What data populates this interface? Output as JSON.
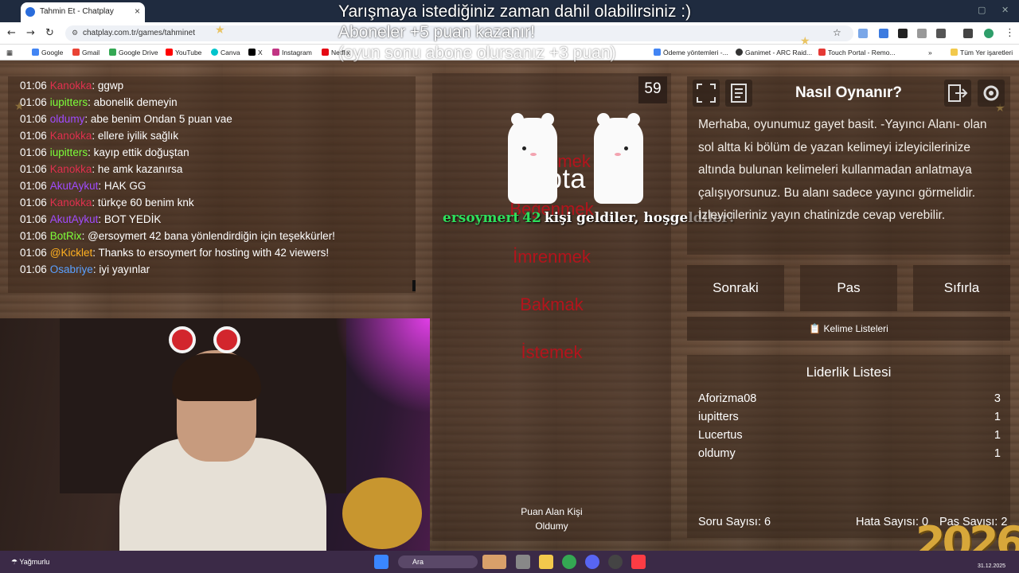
{
  "browser": {
    "tab_title": "Tahmin Et - Chatplay",
    "url": "chatplay.com.tr/games/tahminet",
    "bookmarks": [
      {
        "label": "Google",
        "color": "#4285f4"
      },
      {
        "label": "Gmail",
        "color": "#ea4335"
      },
      {
        "label": "Google Drive",
        "color": "#34a853"
      },
      {
        "label": "YouTube",
        "color": "#ff0000"
      },
      {
        "label": "Canva",
        "color": "#00c4cc"
      },
      {
        "label": "X",
        "color": "#000000"
      },
      {
        "label": "Instagram",
        "color": "#c13584"
      },
      {
        "label": "Netflix",
        "color": "#e50914"
      },
      {
        "label": "Ödeme yöntemleri -...",
        "color": "#4285f4"
      },
      {
        "label": "Ganimet - ARC Raid...",
        "color": "#333333"
      },
      {
        "label": "Touch Portal - Remo...",
        "color": "#e53935"
      }
    ],
    "all_bookmarks": "Tüm Yer işaretleri"
  },
  "announcement": {
    "line1": "Yarışmaya istediğiniz zaman dahil olabilirsiniz :)",
    "line2": "Aboneler +5 puan kazanır!",
    "line3": "(oyun sonu abone olursanız +3 puan)"
  },
  "chat": [
    {
      "time": "01:06",
      "user": "Kanokka",
      "color": "#e0304e",
      "msg": "ggwp"
    },
    {
      "time": "01:06",
      "user": "iupitters",
      "color": "#7dff3a",
      "msg": "abonelik demeyin"
    },
    {
      "time": "01:06",
      "user": "oldumy",
      "color": "#a04bff",
      "msg": "abe benim Ondan 5 puan vae"
    },
    {
      "time": "01:06",
      "user": "Kanokka",
      "color": "#e0304e",
      "msg": "ellere iyilik sağlık"
    },
    {
      "time": "01:06",
      "user": "iupitters",
      "color": "#7dff3a",
      "msg": "kayıp ettik doğuştan"
    },
    {
      "time": "01:06",
      "user": "Kanokka",
      "color": "#e0304e",
      "msg": "he amk kazanırsa"
    },
    {
      "time": "01:06",
      "user": "AkutAykut",
      "color": "#a04bff",
      "msg": "HAK GG"
    },
    {
      "time": "01:06",
      "user": "Kanokka",
      "color": "#e0304e",
      "msg": "türkçe 60 benim knk"
    },
    {
      "time": "01:06",
      "user": "AkutAykut",
      "color": "#a04bff",
      "msg": "BOT YEDİK"
    },
    {
      "time": "01:06",
      "user": "BotRix",
      "color": "#7dff3a",
      "msg": "@ersoymert 42 bana yönlendirdiğin için teşekkürler!"
    },
    {
      "time": "01:06",
      "user": "@Kicklet",
      "color": "#ffb020",
      "msg": "Thanks to ersoymert for hosting with 42 viewers!"
    },
    {
      "time": "01:06",
      "user": "Osabriye",
      "color": "#5aa0ff",
      "msg": "iyi yayınlar"
    }
  ],
  "game": {
    "word": "Gıpta",
    "timer": "59",
    "forbidden": [
      "İmrenmek",
      "Beğenmek",
      "İmrenmek",
      "Bakmak",
      "İstemek"
    ],
    "scorer_label": "Puan Alan Kişi",
    "scorer_name": "Oldumy"
  },
  "host_alert": {
    "user": "ersoymert",
    "count": "42",
    "text": "kişi geldiler, hoşgeldiler!"
  },
  "howto": {
    "title": "Nasıl Oynanır?",
    "text": "Merhaba, oyunumuz gayet basit. -Yayıncı Alanı- olan sol altta ki bölüm de yazan kelimeyi izleyicilerinize altında bulunan kelimeleri kullanmadan anlatmaya çalışıyorsunuz. Bu alanı sadece yayıncı görmelidir. İzleyicileriniz yayın chatinizde cevap verebilir."
  },
  "controls": {
    "next": "Sonraki",
    "pass": "Pas",
    "reset": "Sıfırla",
    "word_lists": "Kelime Listeleri"
  },
  "leaderboard": {
    "title": "Liderlik Listesi",
    "rows": [
      {
        "name": "Aforizma08",
        "score": "3"
      },
      {
        "name": "iupitters",
        "score": "1"
      },
      {
        "name": "Lucertus",
        "score": "1"
      },
      {
        "name": "oldumy",
        "score": "1"
      }
    ]
  },
  "stats": {
    "questions": "Soru Sayısı: 6",
    "errors": "Hata Sayısı: 0",
    "passes": "Pas Sayısı: 2"
  },
  "taskbar": {
    "weather": "Yağmurlu",
    "search": "Ara",
    "date": "31.12.2025"
  },
  "overlay_year": "2026"
}
